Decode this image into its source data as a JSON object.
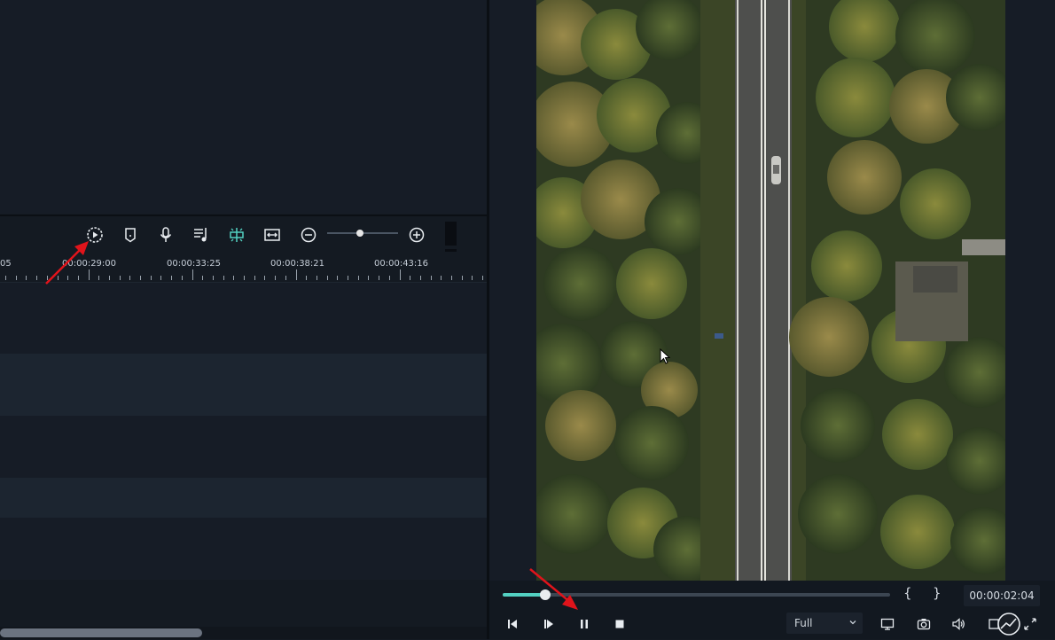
{
  "timeline": {
    "ruler_labels": [
      {
        "text": "05"
      },
      {
        "text": "00:00:29:00"
      },
      {
        "text": "00:00:33:25"
      },
      {
        "text": "00:00:38:21"
      },
      {
        "text": "00:00:43:16"
      }
    ],
    "zoom_level": 0.45
  },
  "preview": {
    "timecode": "00:00:02:04",
    "quality": "Full",
    "mark_in": "{",
    "mark_out": "}",
    "playback_progress": 0.11
  },
  "colors": {
    "accent": "#53d1c2",
    "annotation_arrow": "#e0141b",
    "panel_bg": "#151b24"
  },
  "icons": {
    "toolbar": [
      "render-preview-icon",
      "marker-icon",
      "microphone-icon",
      "audio-mixer-icon",
      "snap-icon",
      "fit-timeline-icon",
      "zoom-out-icon",
      "zoom-in-icon"
    ],
    "playback": [
      "previous-frame-icon",
      "play-icon",
      "pause-icon",
      "stop-icon",
      "display-icon",
      "snapshot-icon",
      "volume-icon",
      "fullscreen-icon"
    ]
  }
}
